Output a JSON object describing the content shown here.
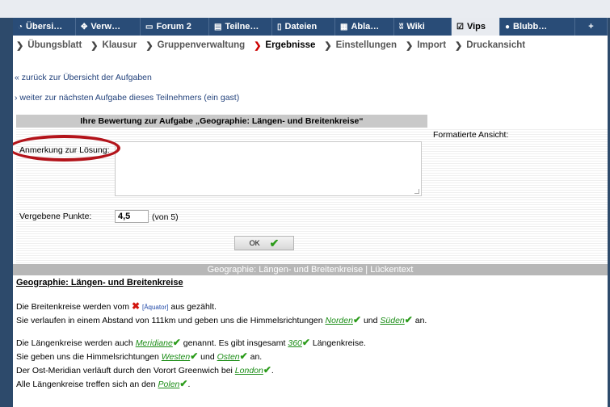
{
  "tabs": [
    {
      "label": "Übersi…",
      "icon": "compass-icon",
      "active": false
    },
    {
      "label": "Verw…",
      "icon": "wrench-icon",
      "active": false
    },
    {
      "label": "Forum 2",
      "icon": "speech-bubble-icon",
      "active": false
    },
    {
      "label": "Teilne…",
      "icon": "people-icon",
      "active": false
    },
    {
      "label": "Dateien",
      "icon": "file-icon",
      "active": false
    },
    {
      "label": "Abla…",
      "icon": "calendar-icon",
      "active": false
    },
    {
      "label": "Wiki",
      "icon": "wiki-icon",
      "active": false
    },
    {
      "label": "Vips",
      "icon": "checkbox-icon",
      "active": true
    },
    {
      "label": "Blubb…",
      "icon": "bubble-icon",
      "active": false
    },
    {
      "label": "+",
      "icon": "",
      "active": false
    }
  ],
  "subnav": [
    {
      "label": "Übungsblatt",
      "active": false
    },
    {
      "label": "Klausur",
      "active": false
    },
    {
      "label": "Gruppenverwaltung",
      "active": false
    },
    {
      "label": "Ergebnisse",
      "active": true
    },
    {
      "label": "Einstellungen",
      "active": false
    },
    {
      "label": "Import",
      "active": false
    },
    {
      "label": "Druckansicht",
      "active": false
    }
  ],
  "links": {
    "back": "« zurück zur Übersicht der Aufgaben",
    "next": "› weiter zur nächsten Aufgabe dieses Teilnehmers (ein gast)"
  },
  "form": {
    "header": "Ihre Bewertung zur Aufgabe „Geographie: Längen- und Breitenkreise“",
    "formatted_label": "Formatierte Ansicht:",
    "comment_label": "Anmerkung zur Lösung:",
    "comment_value": "",
    "points_label": "Vergebene Punkte:",
    "points_value": "4,5",
    "points_max": "(von 5)",
    "ok_label": "OK"
  },
  "content": {
    "bar_title": "Geographie: Längen- und Breitenkreise | Lückentext",
    "title": "Geographie: Längen- und Breitenkreise",
    "l1a": "Die Breitenkreise werden vom ",
    "l1_hint": "[Äquator]",
    "l1b": " aus gezählt.",
    "l2a": "Sie verlaufen in einem Abstand von 111km und geben uns die Himmelsrichtungen ",
    "l2_ans1": "Norden",
    "l2b": " und ",
    "l2_ans2": "Süden",
    "l2c": " an.",
    "l3a": "Die Längenkreise werden auch ",
    "l3_ans1": "Meridiane",
    "l3b": " genannt. Es gibt insgesamt ",
    "l3_ans2": "360",
    "l3c": " Längenkreise.",
    "l4a": "Sie geben uns die Himmelsrichtungen ",
    "l4_ans1": "Westen",
    "l4b": " und ",
    "l4_ans2": "Osten",
    "l4c": " an.",
    "l5a": "Der Ost-Meridian verläuft durch den Vorort Greenwich bei ",
    "l5_ans": "London",
    "l5b": ".",
    "l6a": "Alle Längenkreise treffen sich an den ",
    "l6_ans": "Polen",
    "l6b": "."
  },
  "colors": {
    "tabbar": "#294c77",
    "highlight": "#b3141b",
    "correct": "#1a8c15",
    "wrong": "#d2150f"
  }
}
